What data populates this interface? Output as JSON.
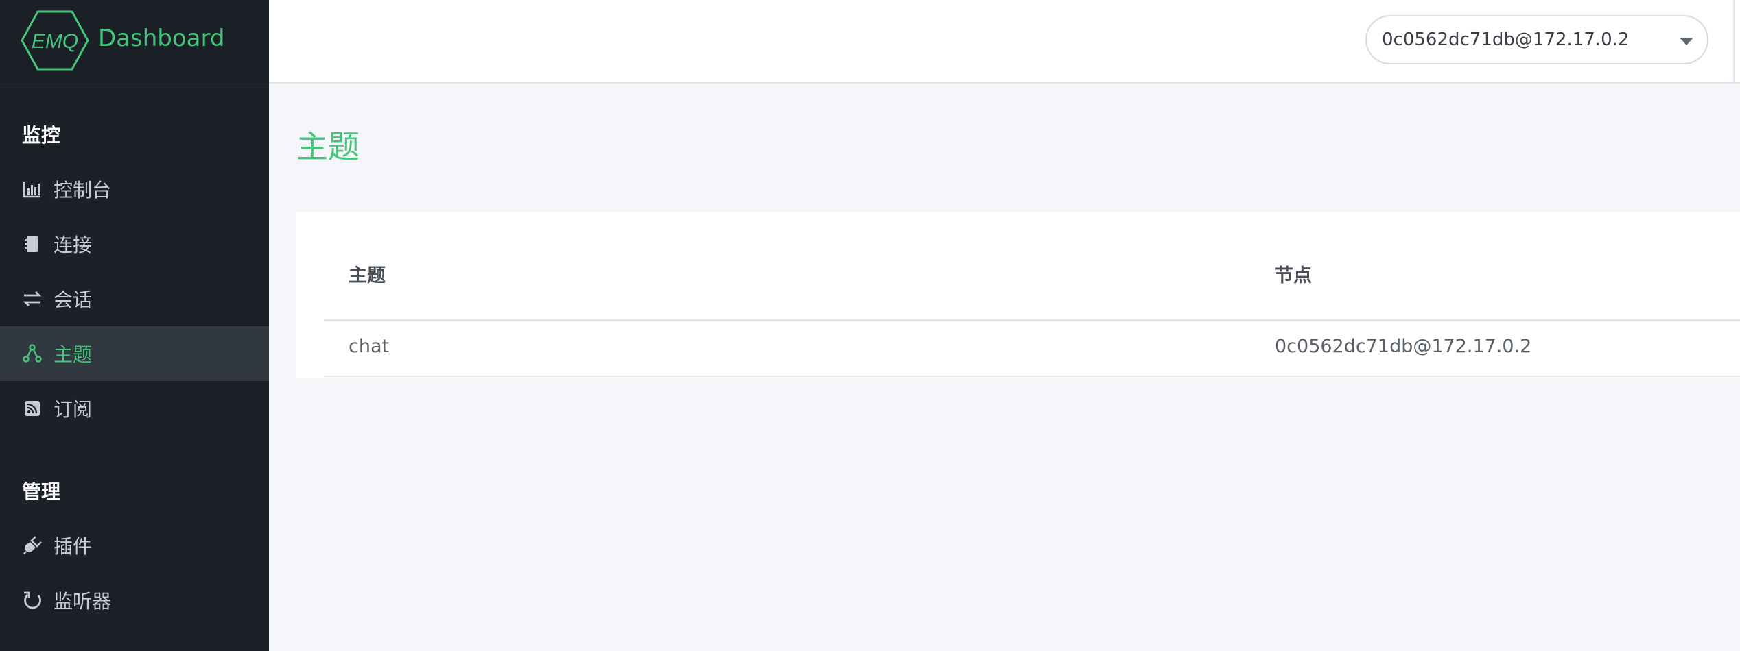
{
  "brand": {
    "logo_text": "EMQ",
    "title": "Dashboard"
  },
  "sidebar": {
    "sections": [
      {
        "title": "监控",
        "items": [
          {
            "label": "控制台",
            "icon": "bar-chart-icon",
            "active": false
          },
          {
            "label": "连接",
            "icon": "device-icon",
            "active": false
          },
          {
            "label": "会话",
            "icon": "exchange-icon",
            "active": false
          },
          {
            "label": "主题",
            "icon": "topic-share-icon",
            "active": true
          },
          {
            "label": "订阅",
            "icon": "rss-icon",
            "active": false
          }
        ]
      },
      {
        "title": "管理",
        "items": [
          {
            "label": "插件",
            "icon": "plug-icon",
            "active": false
          },
          {
            "label": "监听器",
            "icon": "refresh-icon",
            "active": false
          }
        ]
      }
    ]
  },
  "header": {
    "node_selected": "0c0562dc71db@172.17.0.2"
  },
  "main": {
    "page_title": "主题",
    "table": {
      "columns": [
        "主题",
        "节点"
      ],
      "rows": [
        [
          "chat",
          "0c0562dc71db@172.17.0.2"
        ]
      ]
    }
  },
  "colors": {
    "accent": "#45c57c",
    "sidebar_bg": "#1c2027",
    "active_bg": "#323840",
    "page_bg": "#f4f6f9"
  }
}
